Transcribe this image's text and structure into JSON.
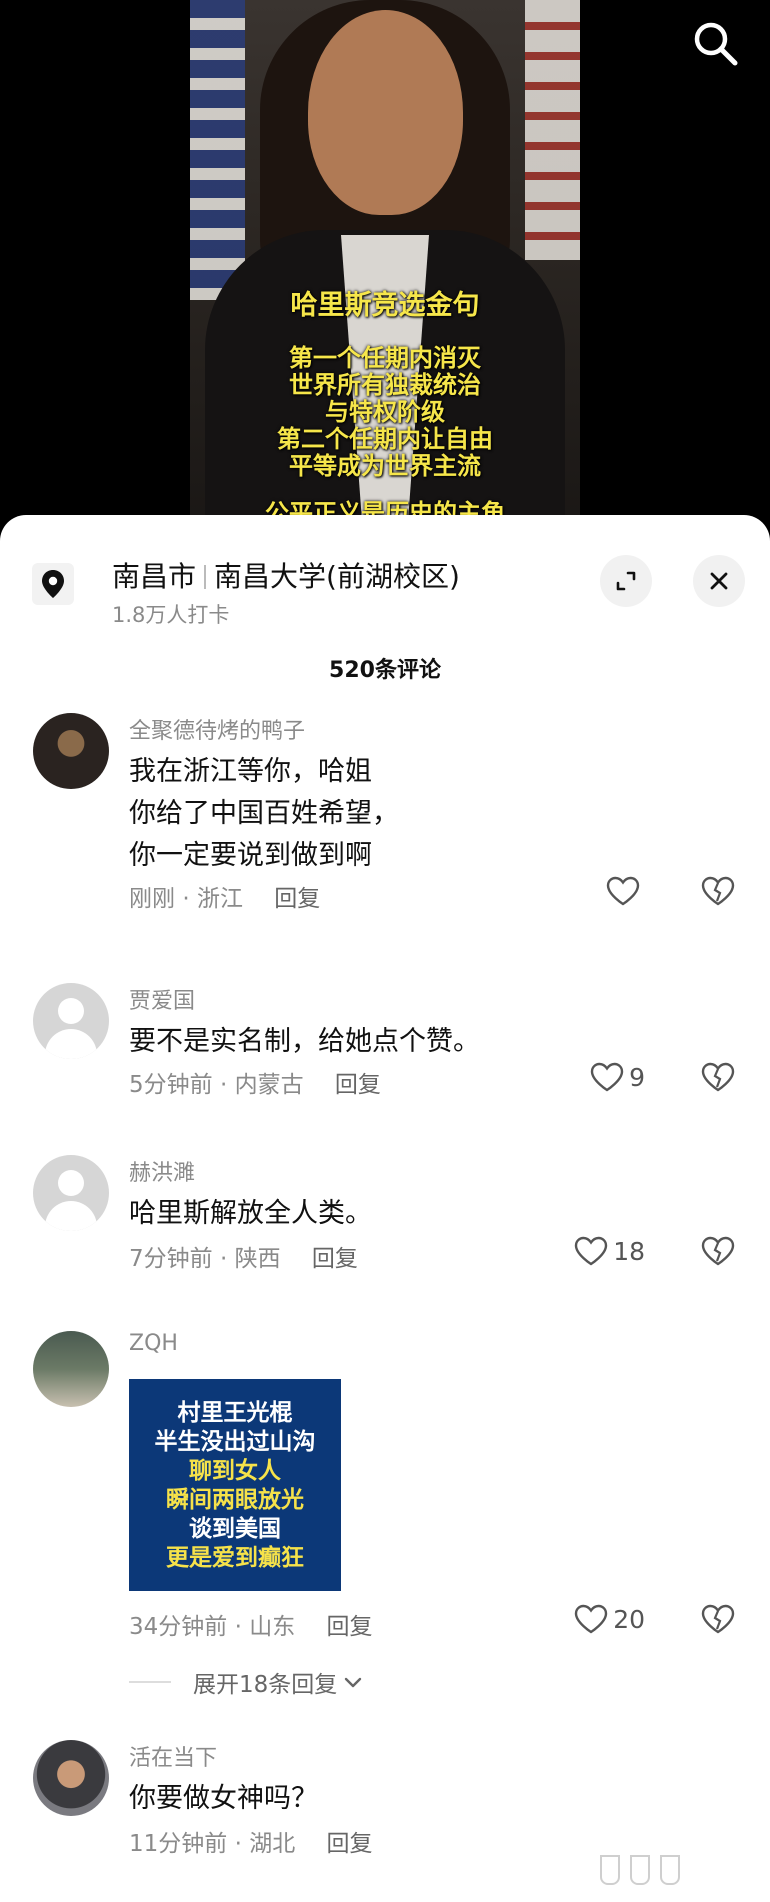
{
  "video": {
    "title": "哈里斯竞选金句",
    "lines": [
      "第一个任期内消灭",
      "世界所有独裁统治",
      "与特权阶级",
      "第二个任期内让自由",
      "平等成为世界主流"
    ],
    "cut_line": "公平正义是历史的主角"
  },
  "location": {
    "city": "南昌市",
    "place": "南昌大学(前湖校区)",
    "checkins": "1.8万人打卡"
  },
  "comments_header": {
    "count_label": "520条评论"
  },
  "comments": [
    {
      "user": "全聚德待烤的鸭子",
      "text": "我在浙江等你，哈姐\n你给了中国百姓希望，\n你一定要说到做到啊",
      "time": "刚刚",
      "region": "浙江",
      "reply": "回复",
      "likes": ""
    },
    {
      "user": "贾爱国",
      "text": "要不是实名制，给她点个赞。",
      "time": "5分钟前",
      "region": "内蒙古",
      "reply": "回复",
      "likes": "9"
    },
    {
      "user": "赫洪濉",
      "text": "哈里斯解放全人类。",
      "time": "7分钟前",
      "region": "陕西",
      "reply": "回复",
      "likes": "18"
    },
    {
      "user": "ZQH",
      "sticker_lines": [
        "村里王光棍",
        "半生没出过山沟",
        "聊到女人",
        "瞬间两眼放光",
        "谈到美国",
        "更是爱到癫狂"
      ],
      "time": "34分钟前",
      "region": "山东",
      "reply": "回复",
      "likes": "20",
      "expand_label": "展开18条回复"
    },
    {
      "user": "活在当下",
      "text": "你要做女神吗？",
      "time": "11分钟前",
      "region": "湖北",
      "reply": "回复",
      "likes": ""
    }
  ],
  "meta_separator": "·",
  "icons": {
    "search": "search-icon",
    "location": "location-pin-icon",
    "expand": "expand-icon",
    "close": "close-icon",
    "like": "heart-outline-icon",
    "dislike": "broken-heart-icon",
    "chevron": "chevron-down-icon"
  },
  "colors": {
    "overlay_text": "#f6e64a",
    "sticker_bg": "#0c3878",
    "sticker_yellow": "#f6e24a"
  }
}
